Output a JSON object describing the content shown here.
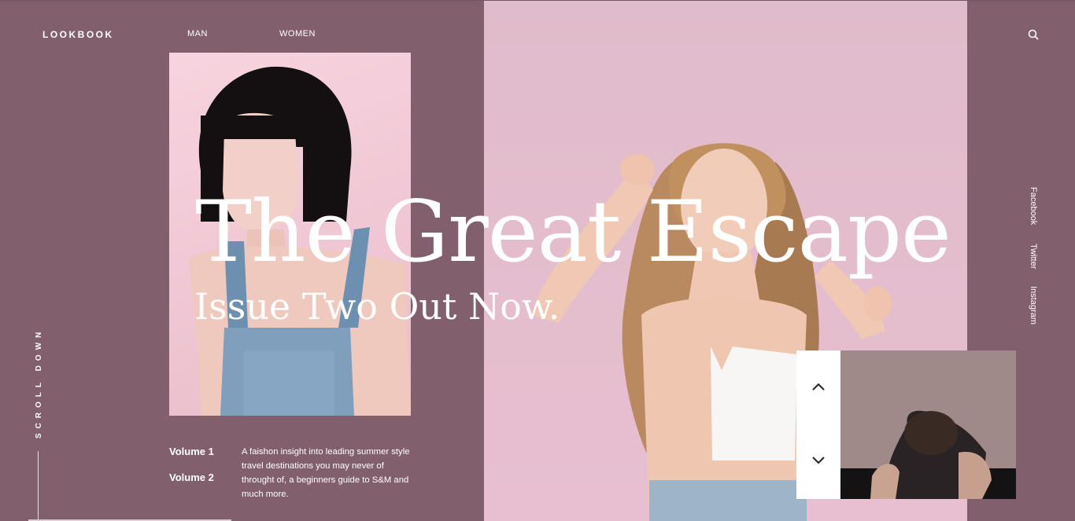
{
  "brand": "LOOKBOOK",
  "nav": {
    "man": "MAN",
    "women": "WOMEN"
  },
  "hero": {
    "title": "The Great Escape",
    "subtitle": "Issue Two Out Now."
  },
  "social": [
    "Facebook",
    "Twitter",
    "Instagram"
  ],
  "scroll_label": "SCROLL DOWN",
  "volumes": [
    "Volume 1",
    "Volume 2"
  ],
  "description": "A faishon insight into leading summer style travel destinations you may never of throught of, a beginners guide to S&M and much more.",
  "icons": {
    "search": "search-icon",
    "up": "chevron-up-icon",
    "down": "chevron-down-icon"
  },
  "colors": {
    "background": "#825f6d",
    "accent": "#ffffff"
  }
}
